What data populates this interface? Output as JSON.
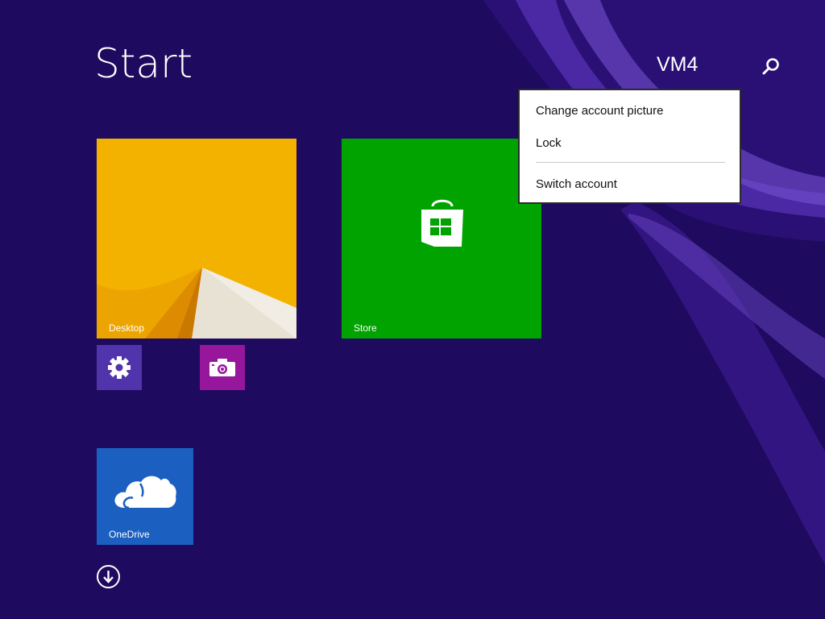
{
  "screen": {
    "title": "Start",
    "user_name": "VM4",
    "background_color": "#1e0a5e",
    "accent_swoosh_color": "#6b3fc8"
  },
  "search": {
    "icon": "search-icon"
  },
  "account_menu": {
    "items": [
      {
        "label": "Change account picture"
      },
      {
        "label": "Lock"
      },
      {
        "label": "Switch account"
      }
    ]
  },
  "tiles": [
    {
      "name": "Desktop",
      "label": "Desktop",
      "color": "#f3b200",
      "icon": "desktop-wallpaper"
    },
    {
      "name": "Store",
      "label": "Store",
      "color": "#00a300",
      "icon": "store-bag-icon"
    },
    {
      "name": "PC settings",
      "label": "",
      "color": "#5133ab",
      "icon": "gear-icon"
    },
    {
      "name": "Camera",
      "label": "",
      "color": "#96169c",
      "icon": "camera-icon"
    },
    {
      "name": "OneDrive",
      "label": "OneDrive",
      "color": "#1b5fc0",
      "icon": "cloud-icon"
    }
  ],
  "all_apps": {
    "icon": "arrow-down-circle-icon"
  }
}
